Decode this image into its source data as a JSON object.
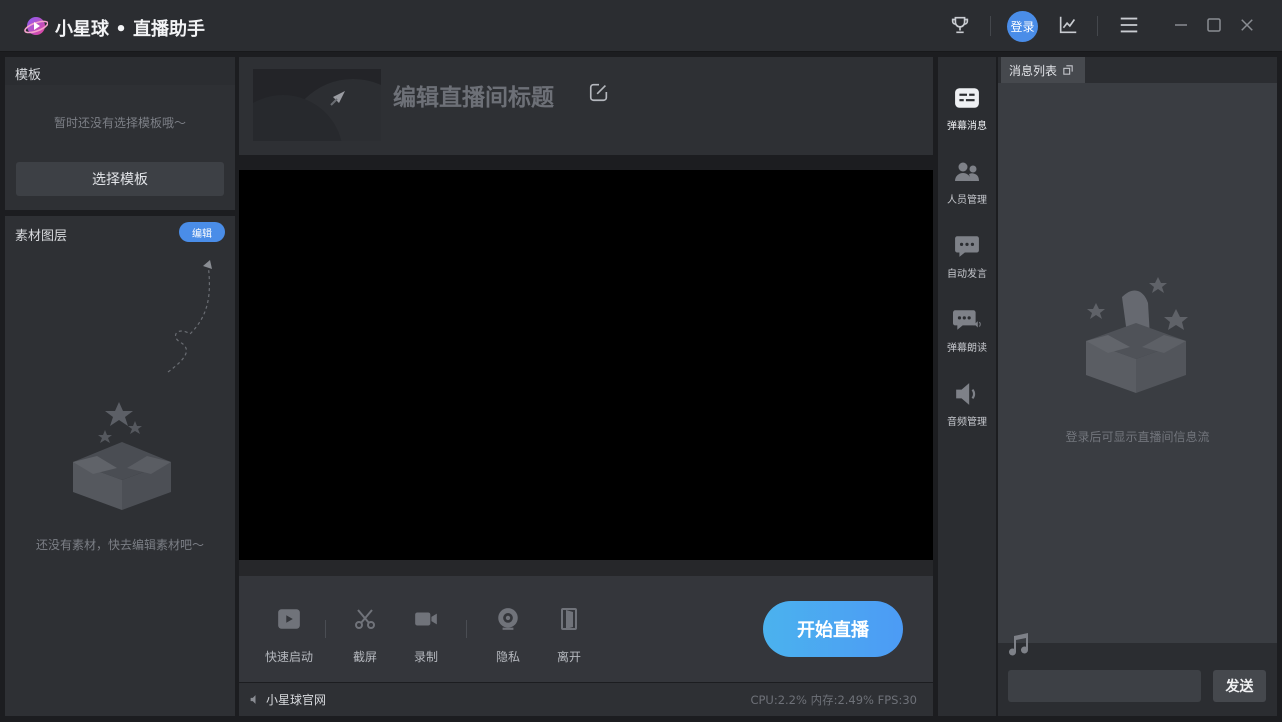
{
  "app": {
    "title": "小星球 • 直播助手"
  },
  "header": {
    "login_label": "登录",
    "icons": [
      "trophy-icon",
      "chart-icon",
      "menu-icon",
      "minimize-icon",
      "maximize-icon",
      "close-icon"
    ]
  },
  "template_panel": {
    "title": "模板",
    "empty_hint": "暂时还没有选择模板哦～",
    "select_button": "选择模板"
  },
  "material_panel": {
    "title": "素材图层",
    "edit_badge": "编辑",
    "empty_hint": "还没有素材，快去编辑素材吧～"
  },
  "stream": {
    "title_placeholder": "编辑直播间标题"
  },
  "toolbar": {
    "tools": [
      {
        "label": "快速启动",
        "icon": "play-icon"
      },
      {
        "label": "截屏",
        "icon": "scissors-icon"
      },
      {
        "label": "录制",
        "icon": "camera-icon"
      },
      {
        "label": "隐私",
        "icon": "webcam-icon"
      },
      {
        "label": "离开",
        "icon": "door-icon"
      }
    ],
    "start_button": "开始直播"
  },
  "statusbar": {
    "site_link": "小星球官网",
    "stats": "CPU:2.2% 内存:2.49% FPS:30"
  },
  "side_nav": {
    "items": [
      {
        "label": "弹幕消息",
        "icon": "danmaku-icon"
      },
      {
        "label": "人员管理",
        "icon": "users-icon"
      },
      {
        "label": "自动发言",
        "icon": "auto-chat-icon"
      },
      {
        "label": "弹幕朗读",
        "icon": "read-aloud-icon"
      },
      {
        "label": "音频管理",
        "icon": "speaker-icon"
      }
    ]
  },
  "message_panel": {
    "tab_label": "消息列表",
    "empty_hint": "登录后可显示直播间信息流",
    "input_placeholder": "",
    "send_button": "发送"
  },
  "colors": {
    "accent": "#4a8de8",
    "start_gradient": [
      "#4bb2ee",
      "#4c9bf5"
    ],
    "panel_bg": "#2e3034",
    "window_bg": "#1c1d20"
  }
}
